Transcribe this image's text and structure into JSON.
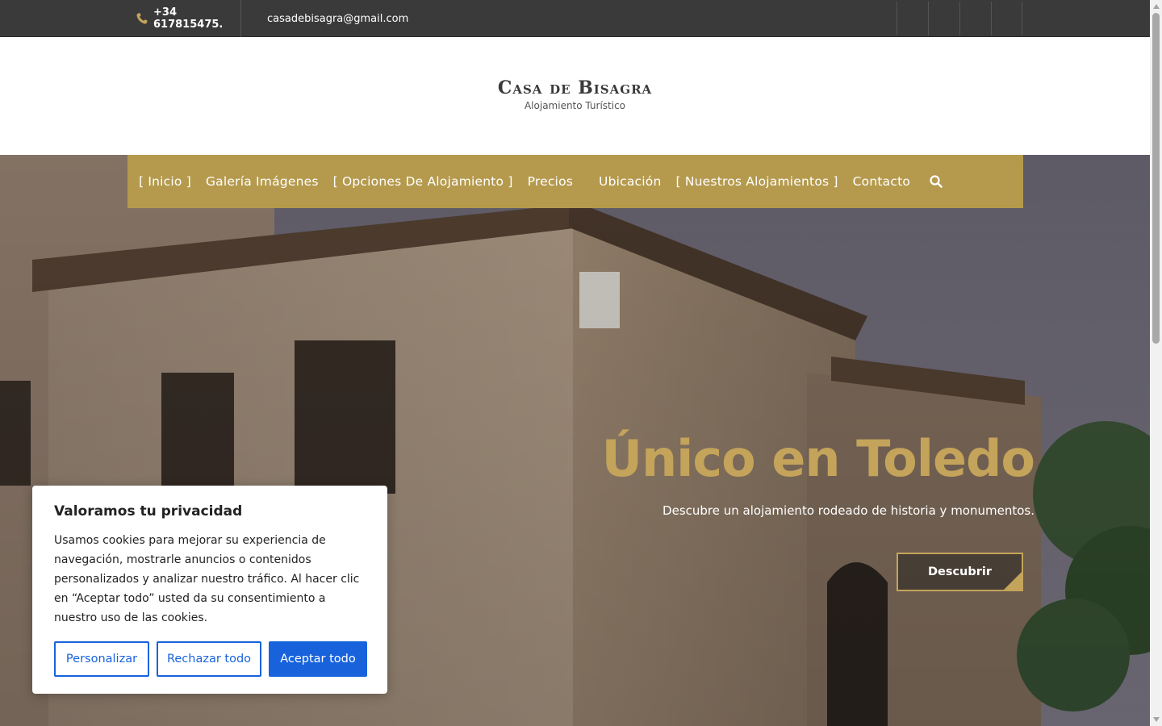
{
  "topbar": {
    "phone": "+34 617815475.",
    "email": "casadebisagra@gmail.com",
    "social": [
      "facebook-icon",
      "instagram-icon",
      "twitter-icon",
      "whatsapp-icon"
    ]
  },
  "brand": {
    "title": "Casa de Bisagra",
    "subtitle": "Alojamiento Turístico"
  },
  "nav": {
    "items": [
      "[  Inicio  ]",
      "Galería Imágenes",
      "[  Opciones De Alojamiento  ]",
      "Precios",
      "Ubicación",
      "[  Nuestros Alojamientos  ]",
      "Contacto"
    ],
    "color": "#b59a4e"
  },
  "hero": {
    "title": "Único en Toledo",
    "subtitle": "Descubre un alojamiento rodeado de historia y monumentos.",
    "button": "Descubrir",
    "accent": "#c4a35a"
  },
  "cookie": {
    "title": "Valoramos tu privacidad",
    "text": "Usamos cookies para mejorar su experiencia de navegación, mostrarle anuncios o contenidos personalizados y analizar nuestro tráfico. Al hacer clic en “Aceptar todo” usted da su consentimiento a nuestro uso de las cookies.",
    "customize": "Personalizar",
    "reject": "Rechazar todo",
    "accept": "Aceptar todo",
    "accent": "#1863dc"
  }
}
